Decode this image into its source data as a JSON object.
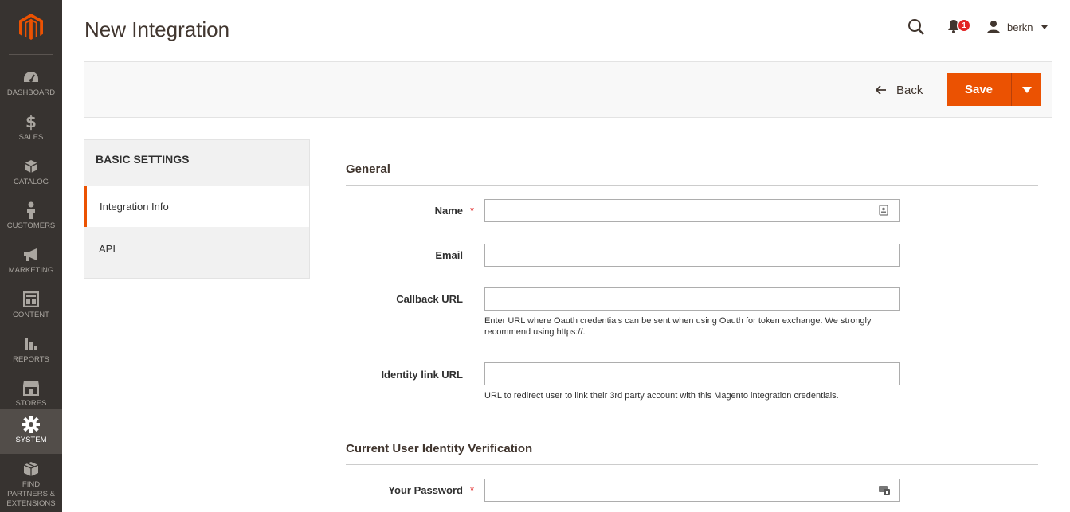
{
  "sidebar": {
    "items": [
      {
        "label": "Dashboard",
        "icon": "dashboard-icon"
      },
      {
        "label": "Sales",
        "icon": "dollar-icon"
      },
      {
        "label": "Catalog",
        "icon": "cube-icon"
      },
      {
        "label": "Customers",
        "icon": "person-icon"
      },
      {
        "label": "Marketing",
        "icon": "megaphone-icon"
      },
      {
        "label": "Content",
        "icon": "layout-icon"
      },
      {
        "label": "Reports",
        "icon": "bar-chart-icon"
      },
      {
        "label": "Stores",
        "icon": "storefront-icon"
      },
      {
        "label": "System",
        "icon": "gear-icon",
        "active": true
      },
      {
        "label": "Find Partners & Extensions",
        "icon": "boxes-icon"
      }
    ]
  },
  "header": {
    "title": "New Integration",
    "notification_count": "1",
    "user_name": "berkn"
  },
  "actions": {
    "back_label": "Back",
    "save_label": "Save"
  },
  "tabs": {
    "title": "Basic Settings",
    "items": [
      {
        "label": "Integration Info",
        "active": true
      },
      {
        "label": "API",
        "active": false
      }
    ]
  },
  "form": {
    "general_title": "General",
    "name_label": "Name",
    "email_label": "Email",
    "callback_label": "Callback URL",
    "callback_note": "Enter URL where Oauth credentials can be sent when using Oauth for token exchange. We strongly recommend using https://.",
    "identity_label": "Identity link URL",
    "identity_note": "URL to redirect user to link their 3rd party account with this Magento integration credentials.",
    "verification_title": "Current User Identity Verification",
    "password_label": "Your Password",
    "name_value": "",
    "email_value": "",
    "callback_value": "",
    "identity_value": "",
    "password_value": ""
  },
  "colors": {
    "accent": "#eb5202",
    "sidebar_bg": "#373330",
    "badge": "#e22626"
  }
}
